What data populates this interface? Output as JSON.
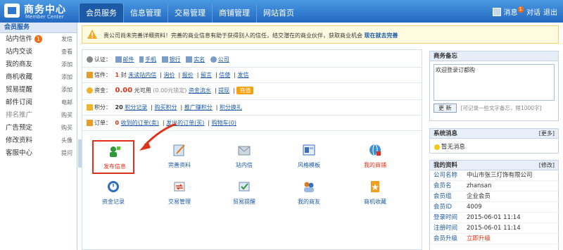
{
  "header": {
    "logo_title": "商务中心",
    "logo_sub": "Member Center",
    "nav": [
      {
        "label": "会员服务",
        "active": true
      },
      {
        "label": "信息管理"
      },
      {
        "label": "交易管理"
      },
      {
        "label": "商铺管理"
      },
      {
        "label": "网站首页"
      }
    ],
    "user": {
      "messages": "消息",
      "msg_count": "1",
      "chat": "对话",
      "logout": "退出"
    }
  },
  "sidebar": {
    "title": "会员服务",
    "items": [
      {
        "label": "站内信件",
        "badge": "1",
        "action": "发信"
      },
      {
        "label": "站内交谈",
        "action": "查看"
      },
      {
        "label": "我的商友",
        "action": "添加"
      },
      {
        "label": "商机收藏",
        "action": "添加"
      },
      {
        "label": "贸易提醒",
        "action": "添加"
      },
      {
        "label": "邮件订阅",
        "action": "电邮"
      },
      {
        "label": "排名推广",
        "action": "购买"
      },
      {
        "label": "广告预定",
        "action": "购买"
      },
      {
        "label": "修改资料",
        "action": "头像"
      },
      {
        "label": "客服中心",
        "action": "提问"
      }
    ]
  },
  "notice": {
    "text": "贵公司尚未完善详细资料！完善的商业信息有助于获得别人的信任，结交潜在的商业伙伴，获取商业机会",
    "link": "现在就去完善"
  },
  "account": {
    "auth_label": "认证：",
    "auth_items": [
      "邮件",
      "手机",
      "银行",
      "实名",
      "公司"
    ],
    "mail_label": "信件：",
    "mail_count": "1",
    "mail_unit": "封",
    "mail_links": [
      "未读站内信",
      "询价",
      "报价",
      "留言",
      "信使",
      "发信"
    ],
    "money_label": "资金：",
    "money_value": "0.00",
    "money_unit": "元可用",
    "money_locked": "(0.00元锁定)",
    "money_links": [
      "资金流水",
      "提现"
    ],
    "money_button": "充值",
    "points_label": "积分：",
    "points_value": "20",
    "points_links": [
      "积分记录",
      "购买积分",
      "推广赚积分",
      "积分换礼"
    ],
    "order_label": "订单：",
    "order_count": "0",
    "order_links": [
      "收到的订单(卖)",
      "发出的订单(买)",
      "购物车(0)"
    ]
  },
  "quick": [
    {
      "label": "发布信息",
      "icon": "publish-icon"
    },
    {
      "label": "完善资料",
      "icon": "profile-edit-icon"
    },
    {
      "label": "站内信",
      "icon": "mail-icon"
    },
    {
      "label": "风格模板",
      "icon": "template-icon"
    },
    {
      "label": "我的商铺",
      "icon": "shop-icon"
    },
    {
      "label": "资金记录",
      "icon": "money-record-icon"
    },
    {
      "label": "交易管理",
      "icon": "trade-icon"
    },
    {
      "label": "贸易提醒",
      "icon": "reminder-icon"
    },
    {
      "label": "我的商友",
      "icon": "friends-icon"
    },
    {
      "label": "商机收藏",
      "icon": "favorites-icon"
    }
  ],
  "memo": {
    "title": "商务备忘",
    "content": "欢迎登录订都购",
    "button": "更 新",
    "hint": "[可记录一些文字备忘，限1000字]"
  },
  "sysmsg": {
    "title": "系统消息",
    "more": "[更多]",
    "text": "暂无消息"
  },
  "myinfo": {
    "title": "我的资料",
    "edit": "[修改]",
    "rows": [
      {
        "k": "公司名称",
        "v": "中山市张三灯饰有限公司"
      },
      {
        "k": "会员名",
        "v": "zhansan"
      },
      {
        "k": "会员组",
        "v": "企业会员"
      },
      {
        "k": "会员ID",
        "v": "4009"
      },
      {
        "k": "登录时间",
        "v": "2015-06-01 11:14"
      },
      {
        "k": "注册时间",
        "v": "2015-06-01 11:14"
      },
      {
        "k": "会员升级",
        "v": "立即升级"
      }
    ]
  },
  "colors": {
    "brand": "#2369c0",
    "accent": "#e0321a",
    "link": "#1d5aa6"
  }
}
